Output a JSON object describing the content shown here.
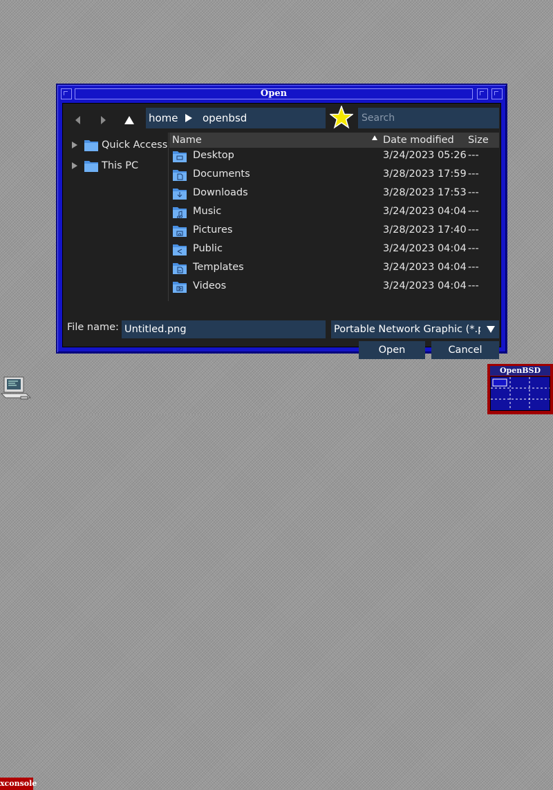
{
  "window": {
    "title": "Open"
  },
  "navigation": {
    "back_icon": "back-arrow-icon",
    "forward_icon": "forward-arrow-icon",
    "up_icon": "up-arrow-icon",
    "path": [
      "home",
      "openbsd"
    ],
    "bookmark_icon": "star-icon",
    "search_placeholder": "Search"
  },
  "sidebar": {
    "items": [
      {
        "label": "Quick Access",
        "icon": "folder-icon"
      },
      {
        "label": "This PC",
        "icon": "folder-icon"
      }
    ]
  },
  "file_list": {
    "columns": {
      "name": "Name",
      "date": "Date modified",
      "size": "Size"
    },
    "sort": "ascending",
    "rows": [
      {
        "name": "Desktop",
        "date": "3/24/2023 05:26",
        "size": "---",
        "icon": "desktop-folder-icon"
      },
      {
        "name": "Documents",
        "date": "3/28/2023 17:59",
        "size": "---",
        "icon": "documents-folder-icon"
      },
      {
        "name": "Downloads",
        "date": "3/28/2023 17:53",
        "size": "---",
        "icon": "downloads-folder-icon"
      },
      {
        "name": "Music",
        "date": "3/24/2023 04:04",
        "size": "---",
        "icon": "music-folder-icon"
      },
      {
        "name": "Pictures",
        "date": "3/28/2023 17:40",
        "size": "---",
        "icon": "pictures-folder-icon"
      },
      {
        "name": "Public",
        "date": "3/24/2023 04:04",
        "size": "---",
        "icon": "public-folder-icon"
      },
      {
        "name": "Templates",
        "date": "3/24/2023 04:04",
        "size": "---",
        "icon": "templates-folder-icon"
      },
      {
        "name": "Videos",
        "date": "3/24/2023 04:04",
        "size": "---",
        "icon": "videos-folder-icon"
      }
    ]
  },
  "bottom": {
    "file_name_label": "File name:",
    "file_name_value": "Untitled.png",
    "filter_value": "Portable Network Graphic (*.pr",
    "open_label": "Open",
    "cancel_label": "Cancel"
  },
  "desktop": {
    "xconsole_label": "xconsole",
    "pager_title": "OpenBSD"
  },
  "colors": {
    "window_frame": "#1414c8",
    "client_bg": "#202020",
    "input_bg": "#243b55",
    "folder_blue": "#4a90e2"
  }
}
